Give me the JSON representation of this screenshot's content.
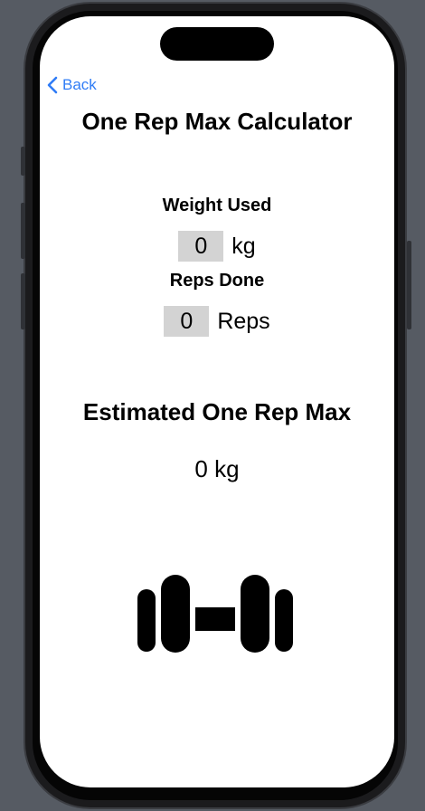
{
  "nav": {
    "back_label": "Back"
  },
  "page": {
    "title": "One Rep Max Calculator"
  },
  "weight": {
    "label": "Weight Used",
    "value": "0",
    "unit": "kg"
  },
  "reps": {
    "label": "Reps Done",
    "value": "0",
    "unit": "Reps"
  },
  "result": {
    "title": "Estimated One Rep Max",
    "value": "0 kg"
  },
  "icons": {
    "back": "chevron-left-icon",
    "hero": "dumbbell-icon"
  },
  "colors": {
    "accent": "#2f7cf6",
    "field_background": "#d3d3d3",
    "text": "#000000",
    "background": "#ffffff"
  }
}
